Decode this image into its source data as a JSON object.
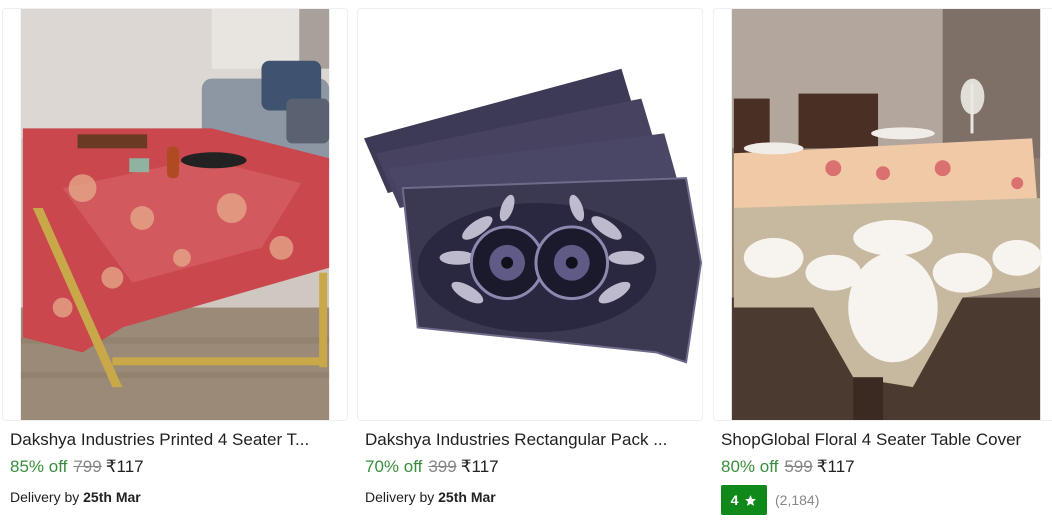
{
  "products": [
    {
      "title": "Dakshya Industries Printed 4 Seater T...",
      "discount": "85% off",
      "mrp": "799",
      "price": "₹117",
      "delivery_prefix": "Delivery by",
      "delivery_date": "25th Mar"
    },
    {
      "title": "Dakshya Industries Rectangular Pack ...",
      "discount": "70% off",
      "mrp": "399",
      "price": "₹117",
      "delivery_prefix": "Delivery by",
      "delivery_date": "25th Mar"
    },
    {
      "title": "ShopGlobal Floral 4 Seater Table Cover",
      "discount": "80% off",
      "mrp": "599",
      "price": "₹117",
      "rating": "4",
      "rating_count": "(2,184)"
    }
  ],
  "colors": {
    "discount": "#388e3c",
    "rating_badge": "#0f8a1a",
    "muted": "#878787"
  },
  "icons": {
    "rating": "star-icon"
  }
}
